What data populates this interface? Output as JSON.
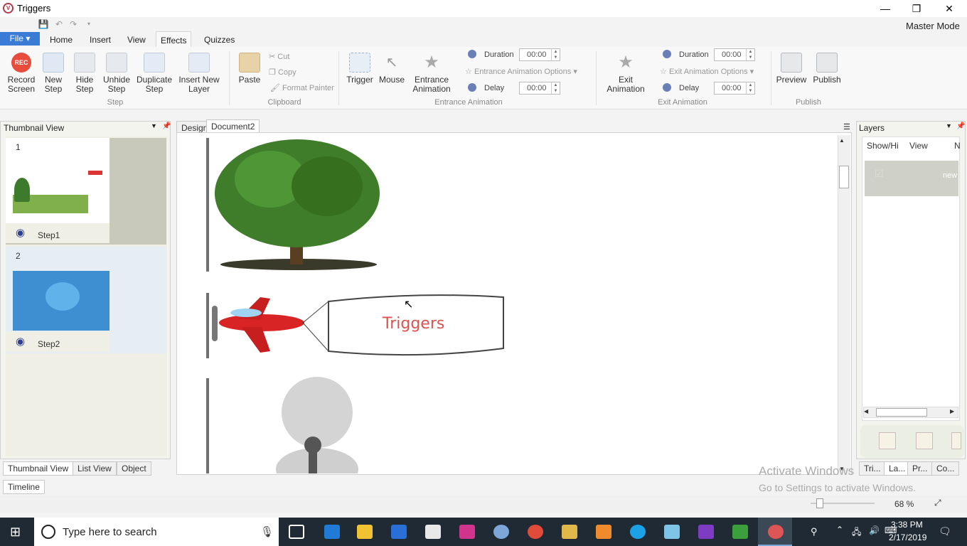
{
  "window": {
    "title": "Triggers",
    "minimize": "—",
    "maximize": "❐",
    "close": "✕"
  },
  "ribbon_tabs": {
    "file": "File",
    "home": "Home",
    "insert": "Insert",
    "view": "View",
    "effects": "Effects",
    "quizzes": "Quizzes"
  },
  "mode": "Master Mode",
  "ribbon": {
    "record": "Record\nScreen",
    "rec_badge": "REC",
    "new_step": "New\nStep",
    "hide_step": "Hide\nStep",
    "unhide_step": "Unhide\nStep",
    "duplicate_step": "Duplicate\nStep",
    "insert_new_layer": "Insert New\nLayer",
    "group_step": "Step",
    "paste": "Paste",
    "cut": "Cut",
    "copy": "Copy",
    "format_painter": "Format Painter",
    "group_clipboard": "Clipboard",
    "trigger": "Trigger",
    "mouse": "Mouse",
    "entrance_animation": "Entrance\nAnimation",
    "duration_label": "Duration",
    "duration_value": "00:00",
    "entrance_options": "Entrance  Animation Options",
    "delay_label": "Delay",
    "delay_value": "00:00",
    "group_entrance": "Entrance Animation",
    "exit_animation": "Exit\nAnimation",
    "exit_duration_label": "Duration",
    "exit_duration_value": "00:00",
    "exit_options": "Exit Animation Options",
    "exit_delay_label": "Delay",
    "exit_delay_value": "00:00",
    "group_exit": "Exit Animation",
    "preview": "Preview",
    "publish": "Publish",
    "group_publish": "Publish"
  },
  "thumbnail_panel": {
    "title": "Thumbnail View",
    "items": [
      {
        "number": "1",
        "label": "Step1"
      },
      {
        "number": "2",
        "label": "Step2"
      }
    ],
    "tabs": {
      "thumbnail": "Thumbnail View",
      "list": "List View",
      "object": "Object"
    }
  },
  "document_tabs": {
    "design": "Design",
    "document": "Document2"
  },
  "canvas": {
    "banner_text": "Triggers"
  },
  "layers_panel": {
    "title": "Layers",
    "col_show": "Show/Hi",
    "col_view": "View",
    "col_name": "N",
    "row_name": "new",
    "tabs": {
      "triggers": "Tri...",
      "layers": "La...",
      "properties": "Pr...",
      "comments": "Co..."
    }
  },
  "timeline_tab": "Timeline",
  "watermark": {
    "line1": "Activate Windows",
    "line2": "Go to Settings to activate Windows."
  },
  "zoom": "68 %",
  "taskbar": {
    "search_placeholder": "Type here to search",
    "time": "3:38 PM",
    "date": "2/17/2019"
  },
  "colors": {
    "file_tab": "#3a7bd5",
    "taskbar": "#1f2a34",
    "record": "#e74c3c",
    "banner_text": "#d9534f"
  }
}
